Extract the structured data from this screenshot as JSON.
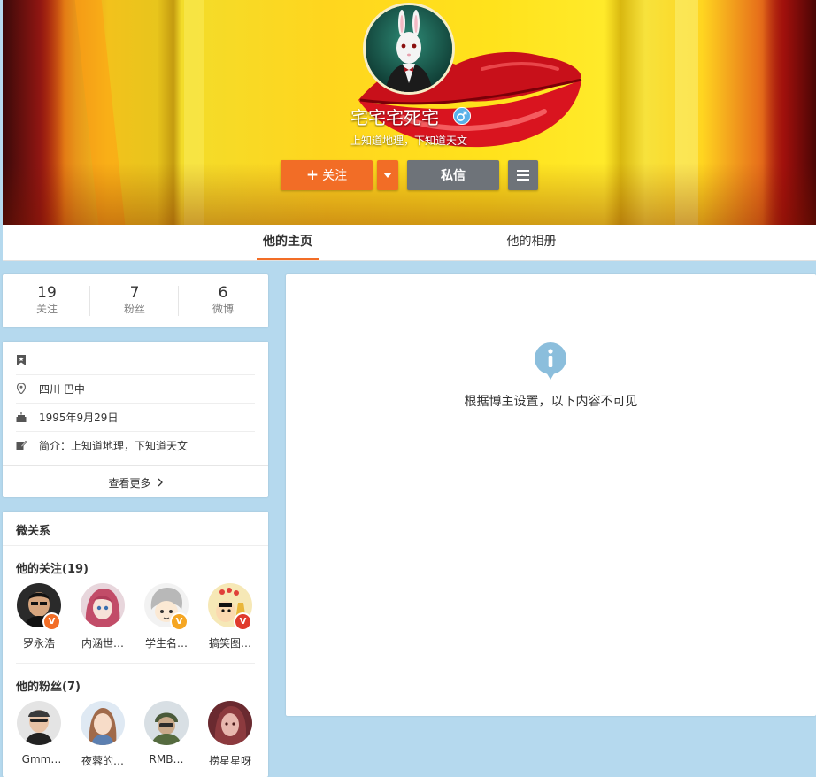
{
  "profile": {
    "name": "宅宅宅死宅",
    "bio_line": "上知道地理，下知道天文",
    "gender_icon": "male-icon"
  },
  "actions": {
    "follow_label": "关注",
    "follow_icon": "plus-icon",
    "message_label": "私信"
  },
  "tabs": [
    {
      "label": "他的主页",
      "active": true
    },
    {
      "label": "他的相册",
      "active": false
    }
  ],
  "counts": [
    {
      "value": "19",
      "label": "关注"
    },
    {
      "value": "7",
      "label": "粉丝"
    },
    {
      "value": "6",
      "label": "微博"
    }
  ],
  "info": {
    "location": "四川 巴中",
    "birthday": "1995年9月29日",
    "intro_label": "简介：",
    "intro_text": "上知道地理，下知道天文",
    "more": "查看更多"
  },
  "relations": {
    "title": "微关系",
    "following_title": "他的关注(19)",
    "following": [
      {
        "name": "罗永浩",
        "verified": true
      },
      {
        "name": "内涵世…",
        "verified": false
      },
      {
        "name": "学生名…",
        "verified": true
      },
      {
        "name": "搞笑图…",
        "verified": true
      }
    ],
    "fans_title": "他的粉丝(7)",
    "fans": [
      {
        "name": "_Gmm…"
      },
      {
        "name": "夜蓉的…"
      },
      {
        "name": "RMB…"
      },
      {
        "name": "捞星星呀"
      }
    ]
  },
  "main": {
    "message": "根据博主设置，以下内容不可见"
  },
  "colors": {
    "accent": "#f26d26",
    "page_bg": "#b5d9ee",
    "grey_button": "#6e7379",
    "info_icon": "#8bbedc"
  }
}
